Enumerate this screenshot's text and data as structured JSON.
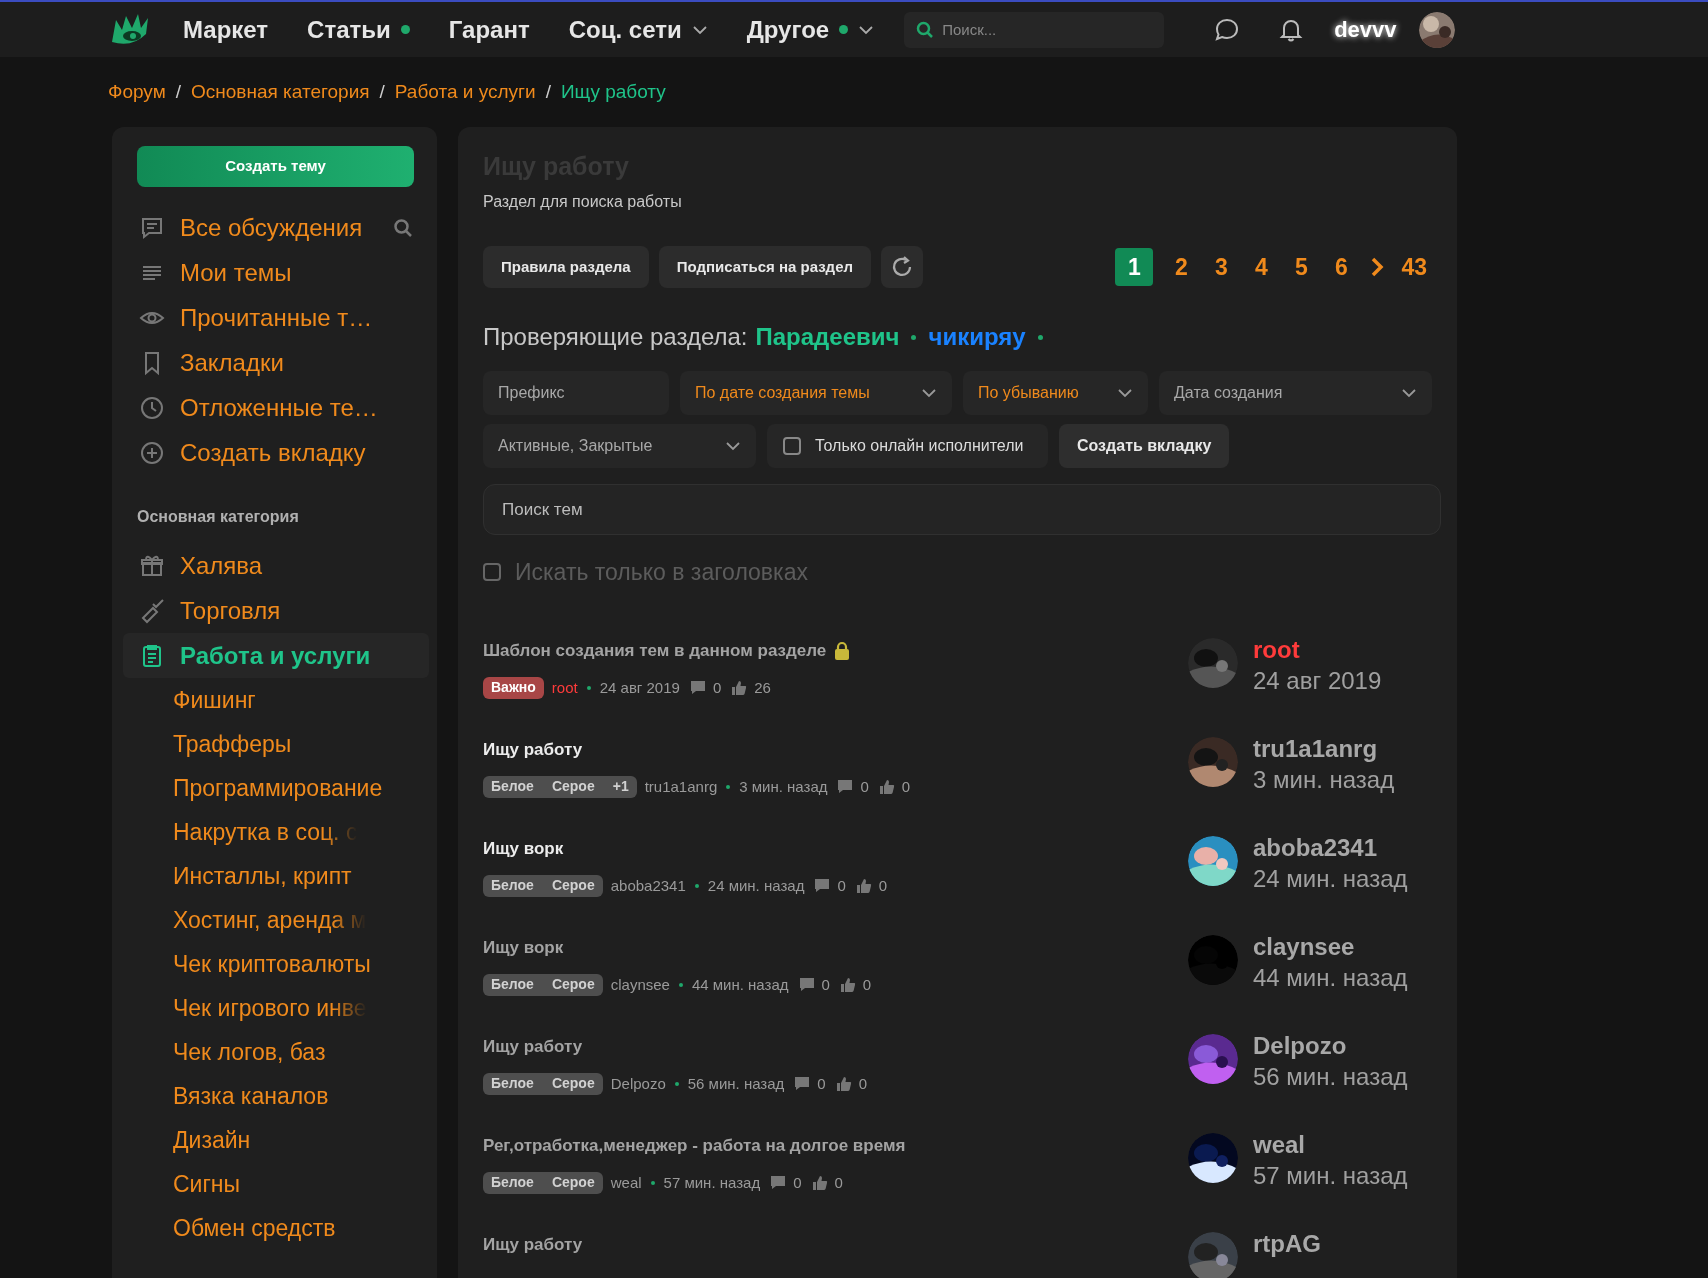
{
  "header": {
    "nav": [
      {
        "label": "Маркет",
        "has_new": false,
        "dropdown": false
      },
      {
        "label": "Статьи",
        "has_new": true,
        "dropdown": false
      },
      {
        "label": "Гарант",
        "has_new": false,
        "dropdown": false
      },
      {
        "label": "Соц. сети",
        "has_new": false,
        "dropdown": true
      },
      {
        "label": "Другое",
        "has_new": true,
        "dropdown": true
      }
    ],
    "search": {
      "placeholder": "Поиск..."
    },
    "username": "devvv"
  },
  "breadcrumbs": [
    {
      "label": "Форум",
      "current": false
    },
    {
      "separator": "/",
      "label": "Основная категория",
      "current": false
    },
    {
      "separator": "/",
      "label": "Работа и услуги",
      "current": false
    },
    {
      "separator": "/",
      "label": "Ищу работу",
      "current": true
    }
  ],
  "sidebar": {
    "create_button": "Создать тему",
    "items": [
      {
        "label": "Все обсуждения",
        "has_search": true
      },
      {
        "label": "Мои темы",
        "has_search": false
      },
      {
        "label": "Прочитанные т…",
        "has_search": false
      },
      {
        "label": "Закладки",
        "has_search": false
      },
      {
        "label": "Отложенные те…",
        "has_search": false
      },
      {
        "label": "Создать вкладку",
        "has_search": false
      }
    ],
    "category": "Основная категория",
    "forums": [
      {
        "label": "Халява",
        "selected": false
      },
      {
        "label": "Торговля",
        "selected": false
      },
      {
        "label": "Работа и услуги",
        "selected": true,
        "children": [
          {
            "label": "Фишинг"
          },
          {
            "label": "Трафферы"
          },
          {
            "label": "Программирование"
          },
          {
            "label": "Накрутка в соц. с",
            "faded": true
          },
          {
            "label": "Инсталлы, крипт"
          },
          {
            "label": "Хостинг, аренда м",
            "faded": true
          },
          {
            "label": "Чек криптовалюты"
          },
          {
            "label": "Чек игрового инве",
            "faded": true
          },
          {
            "label": "Чек логов, баз"
          },
          {
            "label": "Вязка каналов"
          },
          {
            "label": "Дизайн"
          },
          {
            "label": "Сигны"
          },
          {
            "label": "Обмен средств"
          }
        ]
      }
    ]
  },
  "main": {
    "title": "Ищу работу",
    "description": "Раздел для поиска работы",
    "buttons": [
      "Правила раздела",
      "Подписаться на раздел"
    ],
    "pages": [
      {
        "label": "1",
        "selected": true
      },
      {
        "label": "2",
        "selected": false
      },
      {
        "label": "3",
        "selected": false
      },
      {
        "label": "4",
        "selected": false
      },
      {
        "label": "5",
        "selected": false
      },
      {
        "label": "6",
        "selected": false
      }
    ],
    "last_page": "43",
    "reviewers_label": "Проверяющие раздела:",
    "reviewers": [
      {
        "name": "Парадеевич",
        "color": "#1fc48a"
      },
      {
        "name": "чикиряу",
        "color": "#1a82ff"
      }
    ],
    "filters": [
      {
        "label": "Префикс",
        "active": false,
        "dropdown": false
      },
      {
        "label": "По дате создания темы",
        "active": true,
        "dropdown": true
      },
      {
        "label": "По убыванию",
        "active": true,
        "dropdown": true
      },
      {
        "label": "Дата создания",
        "active": false,
        "dropdown": true
      },
      {
        "label": "Активные, Закрытые",
        "active": false,
        "dropdown": true
      }
    ],
    "online_only": {
      "label": "Только онлайн исполнители",
      "checked": false
    },
    "create_tab_button": "Создать вкладку",
    "topic_search": {
      "placeholder": "Поиск тем"
    },
    "titles_only": {
      "label": "Искать только в заголовках",
      "checked": false,
      "disabled": true
    },
    "threads": [
      {
        "title": "Шаблон создания тем в данном разделе",
        "unread": false,
        "locked": true,
        "tags": [
          {
            "label": "Важно",
            "kind": "important"
          }
        ],
        "author": "root",
        "admin": true,
        "time": "24 авг 2019",
        "replies": "0",
        "likes": "26",
        "last_poster": "root",
        "last_time": "24 авг 2019"
      },
      {
        "title": "Ищу работу",
        "unread": true,
        "locked": false,
        "tags": [
          {
            "label": "Белое",
            "kind": "prefix"
          },
          {
            "label": "Серое",
            "kind": "prefix"
          },
          {
            "label": "+1",
            "kind": "prefix"
          }
        ],
        "author": "tru1a1anrg",
        "admin": false,
        "time": "3 мин. назад",
        "replies": "0",
        "likes": "0",
        "last_poster": "tru1a1anrg",
        "last_time": "3 мин. назад"
      },
      {
        "title": "Ищу ворк",
        "unread": true,
        "locked": false,
        "tags": [
          {
            "label": "Белое",
            "kind": "prefix"
          },
          {
            "label": "Серое",
            "kind": "prefix"
          }
        ],
        "author": "aboba2341",
        "admin": false,
        "time": "24 мин. назад",
        "replies": "0",
        "likes": "0",
        "last_poster": "aboba2341",
        "last_time": "24 мин. назад"
      },
      {
        "title": "Ищу ворк",
        "unread": false,
        "locked": false,
        "tags": [
          {
            "label": "Белое",
            "kind": "prefix"
          },
          {
            "label": "Серое",
            "kind": "prefix"
          }
        ],
        "author": "claynsee",
        "admin": false,
        "time": "44 мин. назад",
        "replies": "0",
        "likes": "0",
        "last_poster": "claynsee",
        "last_time": "44 мин. назад"
      },
      {
        "title": "Ищу работу",
        "unread": false,
        "locked": false,
        "tags": [
          {
            "label": "Белое",
            "kind": "prefix"
          },
          {
            "label": "Серое",
            "kind": "prefix"
          }
        ],
        "author": "Delpozo",
        "admin": false,
        "time": "56 мин. назад",
        "replies": "0",
        "likes": "0",
        "last_poster": "Delpozo",
        "last_time": "56 мин. назад"
      },
      {
        "title": "Рег,отработка,менеджер - работа на долгое время",
        "unread": false,
        "locked": false,
        "tags": [
          {
            "label": "Белое",
            "kind": "prefix"
          },
          {
            "label": "Серое",
            "kind": "prefix"
          }
        ],
        "author": "weal",
        "admin": false,
        "time": "57 мин. назад",
        "replies": "0",
        "likes": "0",
        "last_poster": "weal",
        "last_time": "57 мин. назад"
      },
      {
        "title": "Ищу работу",
        "unread": false,
        "locked": false,
        "last_poster": "rtpAG"
      }
    ]
  }
}
